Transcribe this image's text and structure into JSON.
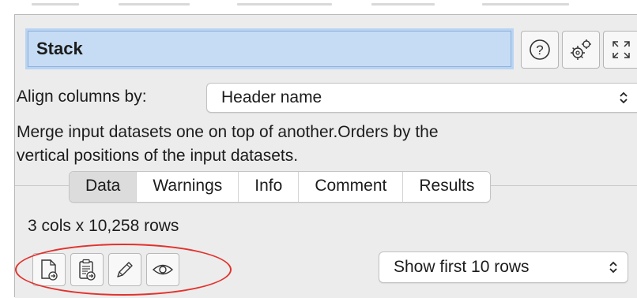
{
  "panel": {
    "title": "Stack",
    "toolbar": {
      "help_icon": "help-circle-icon",
      "settings_icon": "gears-icon",
      "maximize_icon": "expand-arrows-icon"
    }
  },
  "align": {
    "label": "Align columns by:",
    "selected": "Header name"
  },
  "description": {
    "line1": "Merge input datasets one on top of another.Orders by the",
    "line2": "vertical positions of the input datasets."
  },
  "tabs": [
    {
      "label": "Data",
      "active": true
    },
    {
      "label": "Warnings",
      "active": false
    },
    {
      "label": "Info",
      "active": false
    },
    {
      "label": "Comment",
      "active": false
    },
    {
      "label": "Results",
      "active": false
    }
  ],
  "data_view": {
    "row_count": "3 cols x 10,258 rows",
    "show_select": "Show first 10 rows",
    "actions": [
      {
        "icon": "new-document-icon"
      },
      {
        "icon": "clipboard-add-icon"
      },
      {
        "icon": "pencil-icon"
      },
      {
        "icon": "eye-icon"
      }
    ]
  },
  "colors": {
    "title_bg": "#c6dcf5",
    "panel_bg": "#ececec",
    "highlight": "#e2322d"
  }
}
